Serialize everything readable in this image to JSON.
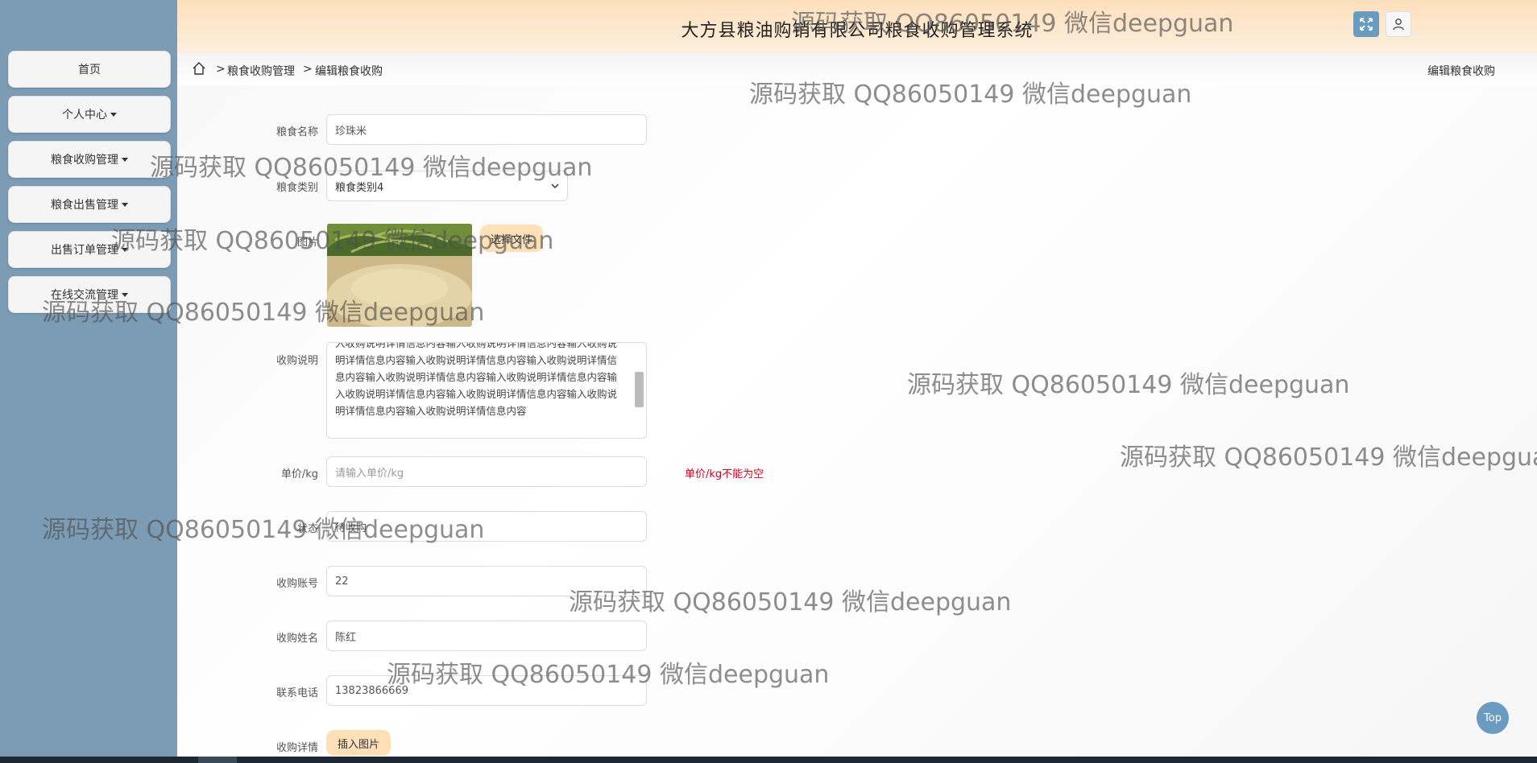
{
  "app": {
    "title": "大方县粮油购销有限公司粮食收购管理系统"
  },
  "sidebar": {
    "items": [
      {
        "label": "首页",
        "has_caret": false
      },
      {
        "label": "个人中心",
        "has_caret": true
      },
      {
        "label": "粮食收购管理",
        "has_caret": true
      },
      {
        "label": "粮食出售管理",
        "has_caret": true
      },
      {
        "label": "出售订单管理",
        "has_caret": true
      },
      {
        "label": "在线交流管理",
        "has_caret": true
      }
    ]
  },
  "breadcrumb": {
    "items": [
      "粮食收购管理",
      "编辑粮食收购"
    ],
    "separator": ">",
    "page_label": "编辑粮食收购"
  },
  "form": {
    "name": {
      "label": "粮食名称",
      "value": "珍珠米"
    },
    "category": {
      "label": "粮食类别",
      "value": "粮食类别4"
    },
    "image": {
      "label": "图片",
      "button": "选择文件"
    },
    "description": {
      "label": "收购说明",
      "value": "入收购说明详情信息内容输入收购说明详情信息内容输入收购说明详情信息内容输入收购说明详情信息内容输入收购说明详情信息内容输入收购说明详情信息内容输入收购说明详情信息内容输入收购说明详情信息内容输入收购说明详情信息内容输入收购说明详情信息内容输入收购说明详情信息内容"
    },
    "price": {
      "label": "单价/kg",
      "placeholder": "请输入单价/kg",
      "error": "单价/kg不能为空"
    },
    "status": {
      "label": "状态",
      "value": "待收购"
    },
    "account": {
      "label": "收购账号",
      "value": "22"
    },
    "buyer_name": {
      "label": "收购姓名",
      "value": "陈红"
    },
    "phone": {
      "label": "联系电话",
      "value": "13823866669"
    },
    "detail": {
      "label": "收购详情",
      "button": "插入图片"
    }
  },
  "watermark_text": "源码获取 QQ86050149 微信deepguan",
  "watermark_text_cut": "源码获取 QQ86050149 微信deepgua",
  "top_button": "Top",
  "colors": {
    "sidebar": "#7b9cb4",
    "header": "#fde0bd",
    "accent": "#6a9bc0",
    "error": "#d0021b",
    "orange_button": "#fde0b8"
  },
  "icons": [
    "fullscreen-icon",
    "user-icon",
    "home-icon",
    "chevron-down-icon"
  ]
}
